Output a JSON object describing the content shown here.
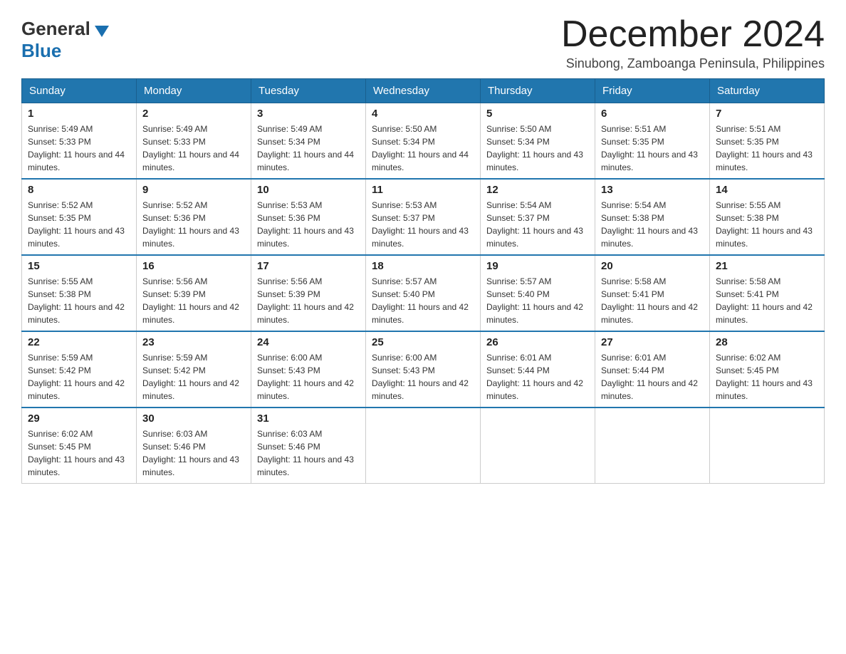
{
  "header": {
    "logo_line1": "General",
    "logo_line2": "Blue",
    "month_title": "December 2024",
    "subtitle": "Sinubong, Zamboanga Peninsula, Philippines"
  },
  "days_of_week": [
    "Sunday",
    "Monday",
    "Tuesday",
    "Wednesday",
    "Thursday",
    "Friday",
    "Saturday"
  ],
  "weeks": [
    [
      {
        "day": "1",
        "sunrise": "5:49 AM",
        "sunset": "5:33 PM",
        "daylight": "11 hours and 44 minutes."
      },
      {
        "day": "2",
        "sunrise": "5:49 AM",
        "sunset": "5:33 PM",
        "daylight": "11 hours and 44 minutes."
      },
      {
        "day": "3",
        "sunrise": "5:49 AM",
        "sunset": "5:34 PM",
        "daylight": "11 hours and 44 minutes."
      },
      {
        "day": "4",
        "sunrise": "5:50 AM",
        "sunset": "5:34 PM",
        "daylight": "11 hours and 44 minutes."
      },
      {
        "day": "5",
        "sunrise": "5:50 AM",
        "sunset": "5:34 PM",
        "daylight": "11 hours and 43 minutes."
      },
      {
        "day": "6",
        "sunrise": "5:51 AM",
        "sunset": "5:35 PM",
        "daylight": "11 hours and 43 minutes."
      },
      {
        "day": "7",
        "sunrise": "5:51 AM",
        "sunset": "5:35 PM",
        "daylight": "11 hours and 43 minutes."
      }
    ],
    [
      {
        "day": "8",
        "sunrise": "5:52 AM",
        "sunset": "5:35 PM",
        "daylight": "11 hours and 43 minutes."
      },
      {
        "day": "9",
        "sunrise": "5:52 AM",
        "sunset": "5:36 PM",
        "daylight": "11 hours and 43 minutes."
      },
      {
        "day": "10",
        "sunrise": "5:53 AM",
        "sunset": "5:36 PM",
        "daylight": "11 hours and 43 minutes."
      },
      {
        "day": "11",
        "sunrise": "5:53 AM",
        "sunset": "5:37 PM",
        "daylight": "11 hours and 43 minutes."
      },
      {
        "day": "12",
        "sunrise": "5:54 AM",
        "sunset": "5:37 PM",
        "daylight": "11 hours and 43 minutes."
      },
      {
        "day": "13",
        "sunrise": "5:54 AM",
        "sunset": "5:38 PM",
        "daylight": "11 hours and 43 minutes."
      },
      {
        "day": "14",
        "sunrise": "5:55 AM",
        "sunset": "5:38 PM",
        "daylight": "11 hours and 43 minutes."
      }
    ],
    [
      {
        "day": "15",
        "sunrise": "5:55 AM",
        "sunset": "5:38 PM",
        "daylight": "11 hours and 42 minutes."
      },
      {
        "day": "16",
        "sunrise": "5:56 AM",
        "sunset": "5:39 PM",
        "daylight": "11 hours and 42 minutes."
      },
      {
        "day": "17",
        "sunrise": "5:56 AM",
        "sunset": "5:39 PM",
        "daylight": "11 hours and 42 minutes."
      },
      {
        "day": "18",
        "sunrise": "5:57 AM",
        "sunset": "5:40 PM",
        "daylight": "11 hours and 42 minutes."
      },
      {
        "day": "19",
        "sunrise": "5:57 AM",
        "sunset": "5:40 PM",
        "daylight": "11 hours and 42 minutes."
      },
      {
        "day": "20",
        "sunrise": "5:58 AM",
        "sunset": "5:41 PM",
        "daylight": "11 hours and 42 minutes."
      },
      {
        "day": "21",
        "sunrise": "5:58 AM",
        "sunset": "5:41 PM",
        "daylight": "11 hours and 42 minutes."
      }
    ],
    [
      {
        "day": "22",
        "sunrise": "5:59 AM",
        "sunset": "5:42 PM",
        "daylight": "11 hours and 42 minutes."
      },
      {
        "day": "23",
        "sunrise": "5:59 AM",
        "sunset": "5:42 PM",
        "daylight": "11 hours and 42 minutes."
      },
      {
        "day": "24",
        "sunrise": "6:00 AM",
        "sunset": "5:43 PM",
        "daylight": "11 hours and 42 minutes."
      },
      {
        "day": "25",
        "sunrise": "6:00 AM",
        "sunset": "5:43 PM",
        "daylight": "11 hours and 42 minutes."
      },
      {
        "day": "26",
        "sunrise": "6:01 AM",
        "sunset": "5:44 PM",
        "daylight": "11 hours and 42 minutes."
      },
      {
        "day": "27",
        "sunrise": "6:01 AM",
        "sunset": "5:44 PM",
        "daylight": "11 hours and 42 minutes."
      },
      {
        "day": "28",
        "sunrise": "6:02 AM",
        "sunset": "5:45 PM",
        "daylight": "11 hours and 43 minutes."
      }
    ],
    [
      {
        "day": "29",
        "sunrise": "6:02 AM",
        "sunset": "5:45 PM",
        "daylight": "11 hours and 43 minutes."
      },
      {
        "day": "30",
        "sunrise": "6:03 AM",
        "sunset": "5:46 PM",
        "daylight": "11 hours and 43 minutes."
      },
      {
        "day": "31",
        "sunrise": "6:03 AM",
        "sunset": "5:46 PM",
        "daylight": "11 hours and 43 minutes."
      },
      null,
      null,
      null,
      null
    ]
  ],
  "labels": {
    "sunrise": "Sunrise:",
    "sunset": "Sunset:",
    "daylight": "Daylight:"
  }
}
